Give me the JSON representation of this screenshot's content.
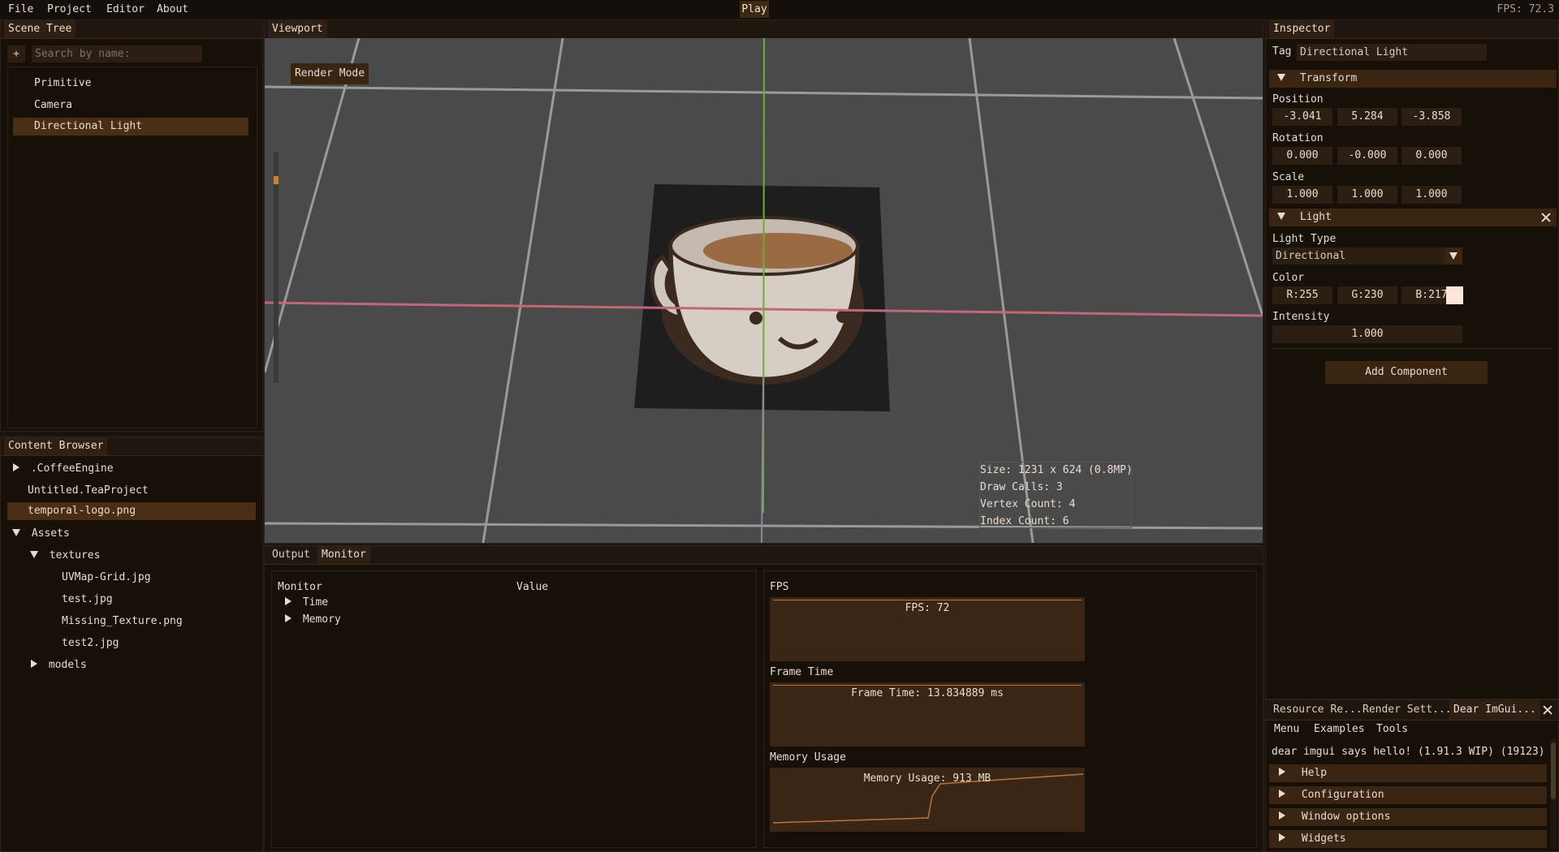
{
  "menubar": {
    "items": [
      "File",
      "Project",
      "Editor",
      "About"
    ],
    "play_label": "Play",
    "fps": "FPS: 72.3"
  },
  "scene_tree": {
    "tab": "Scene Tree",
    "add_label": "+",
    "search_placeholder": "Search by name:",
    "items": [
      "Primitive",
      "Camera",
      "Directional Light"
    ],
    "selected": "Directional Light"
  },
  "content_browser": {
    "tab": "Content Browser",
    "items": [
      ".CoffeeEngine",
      "Untitled.TeaProject",
      "temporal-logo.png",
      "Assets",
      "textures",
      "UVMap-Grid.jpg",
      "test.jpg",
      "Missing_Texture.png",
      "test2.jpg",
      "models"
    ]
  },
  "viewport": {
    "tab": "Viewport",
    "render_mode": "Render Mode",
    "stats": [
      "Size: 1231 x 624 (0.8MP)",
      "Draw Calls: 3",
      "Vertex Count: 4",
      "Index Count: 6"
    ]
  },
  "bottom": {
    "tabs": [
      "Output",
      "Monitor"
    ],
    "monitor": {
      "col_monitor": "Monitor",
      "col_value": "Value",
      "rows": [
        "Time",
        "Memory"
      ]
    },
    "graphs": {
      "fps_heading": "FPS",
      "fps_title": "FPS: 72",
      "frametime_heading": "Frame Time",
      "frametime_title": "Frame Time: 13.834889 ms",
      "memory_heading": "Memory Usage",
      "memory_title": "Memory Usage: 913 MB"
    }
  },
  "inspector": {
    "tab": "Inspector",
    "tag_label": "Tag",
    "tag_value": "Directional Light",
    "transform_header": "Transform",
    "position_label": "Position",
    "position": [
      "-3.041",
      "5.284",
      "-3.858"
    ],
    "rotation_label": "Rotation",
    "rotation": [
      "0.000",
      "-0.000",
      "0.000"
    ],
    "scale_label": "Scale",
    "scale": [
      "1.000",
      "1.000",
      "1.000"
    ],
    "light_header": "Light",
    "light_type_label": "Light Type",
    "light_type": "Directional",
    "color_label": "Color",
    "color": [
      "R:255",
      "G:230",
      "B:217"
    ],
    "color_swatch": "#ffe6d9",
    "intensity_label": "Intensity",
    "intensity": "1.000",
    "add_component": "Add Component"
  },
  "imgui": {
    "tabs": [
      "Resource Re...",
      "Render Sett...",
      "Dear ImGui..."
    ],
    "menu": [
      "Menu",
      "Examples",
      "Tools"
    ],
    "hello": "dear imgui says hello! (1.91.3 WIP) (19123)",
    "sections": [
      "Help",
      "Configuration",
      "Window options",
      "Widgets"
    ]
  },
  "colors": {
    "accent": "#4a2d15",
    "header": "#3a2412",
    "panel": "#161009"
  }
}
